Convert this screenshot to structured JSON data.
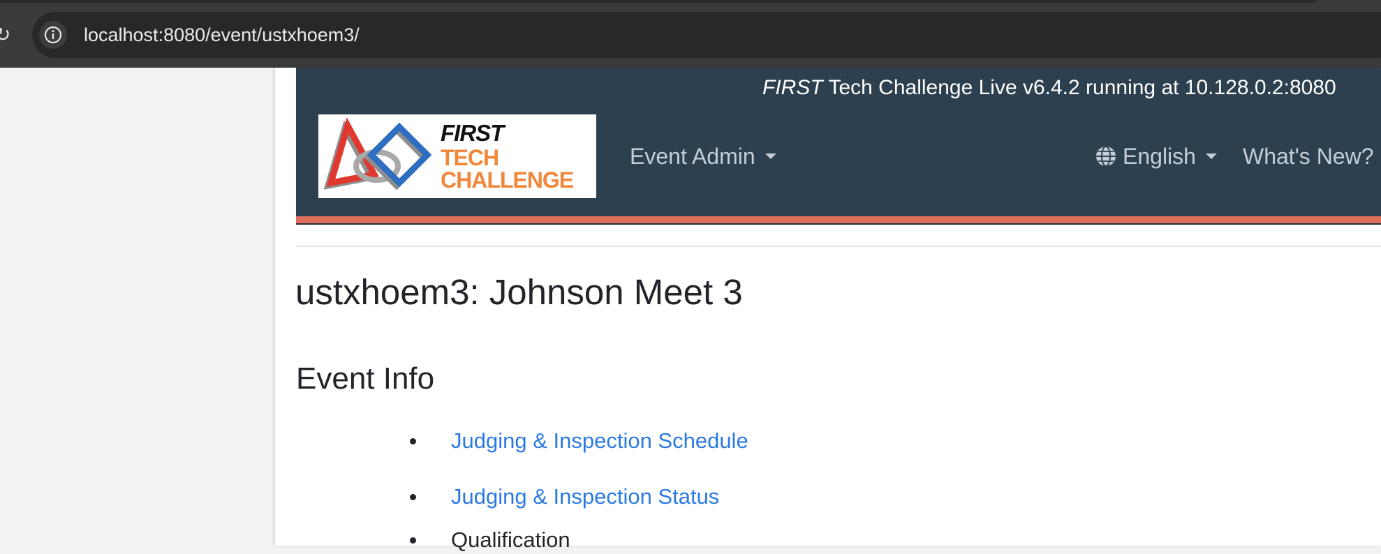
{
  "browser": {
    "url": "localhost:8080/event/ustxhoem3/"
  },
  "header": {
    "version_italic": "FIRST",
    "version_rest": "Tech Challenge Live v6.4.2 running at 10.128.0.2:8080",
    "logo": {
      "line1": "FIRST",
      "line2": "TECH",
      "line3": "CHALLENGE"
    },
    "nav": {
      "event_admin": "Event Admin",
      "language": "English",
      "whats_new": "What's New?"
    }
  },
  "main": {
    "title": "ustxhoem3: Johnson Meet 3",
    "section_title": "Event Info",
    "items": [
      {
        "label": "Judging & Inspection Schedule"
      },
      {
        "label": "Judging & Inspection Status"
      },
      {
        "label": "Qualification"
      }
    ]
  },
  "colors": {
    "header_bg": "#2d4050",
    "accent_stripe": "#e0705e",
    "link": "#2a7ae2",
    "logo_red": "#e0382f",
    "logo_blue": "#2d6ec1",
    "logo_orange": "#f0873a"
  }
}
